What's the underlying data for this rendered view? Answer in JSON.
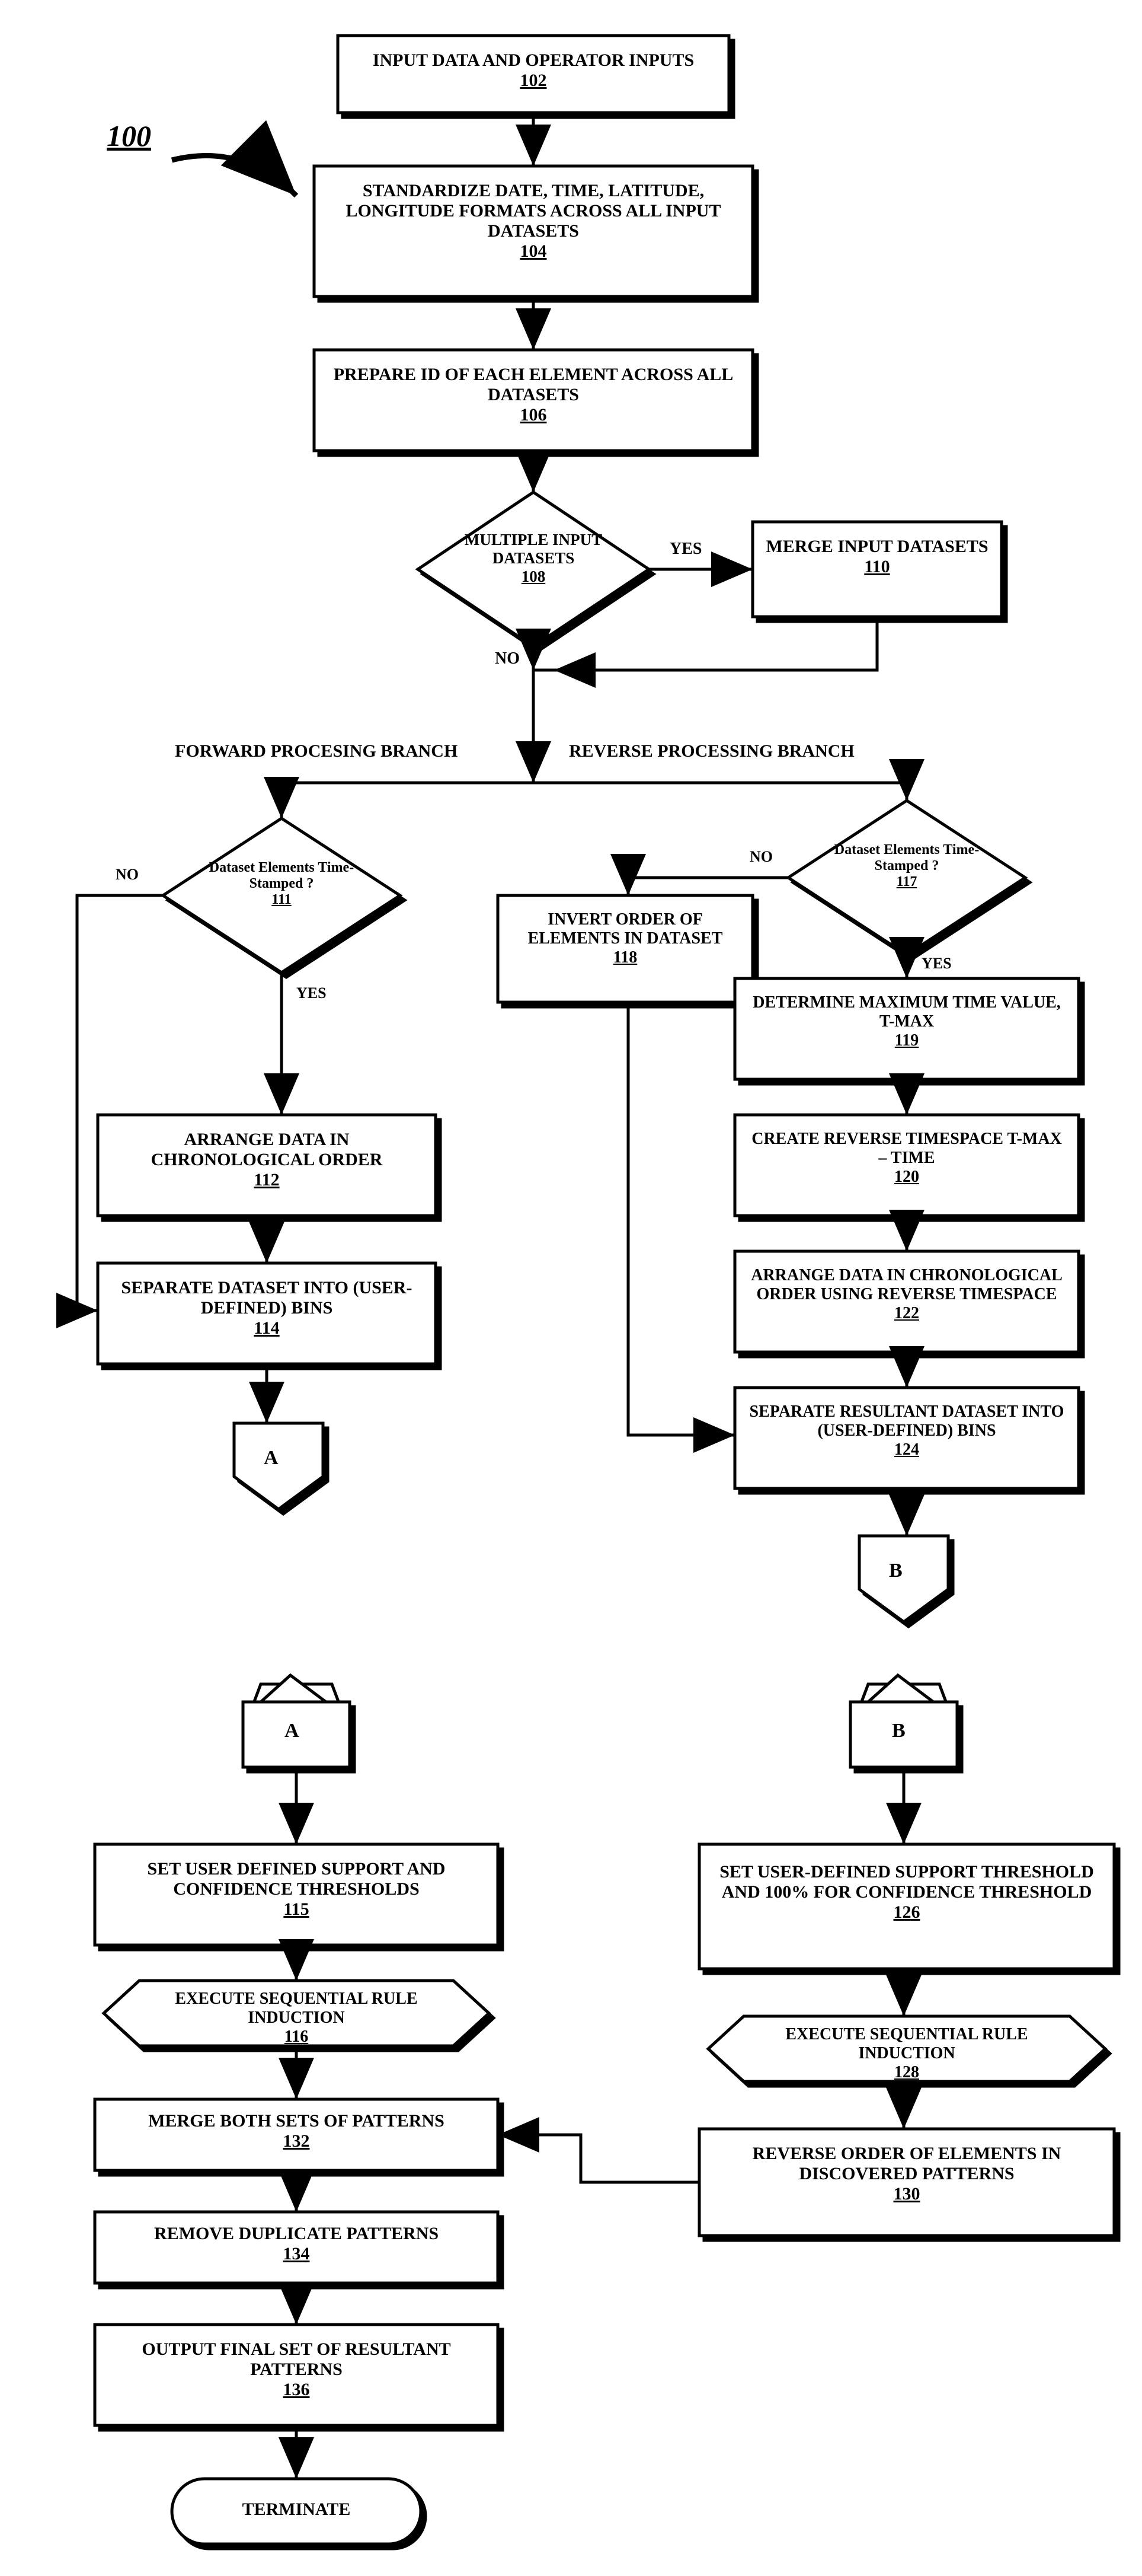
{
  "figure_label": "100",
  "branches": {
    "forward": "FORWARD  PROCESING BRANCH",
    "reverse": "REVERSE PROCESSING BRANCH"
  },
  "edge_labels": {
    "yes": "YES",
    "no": "NO"
  },
  "nodes": {
    "n102": {
      "text": "INPUT DATA AND OPERATOR INPUTS",
      "ref": "102"
    },
    "n104": {
      "text": "STANDARDIZE DATE, TIME, LATITUDE, LONGITUDE FORMATS ACROSS ALL INPUT DATASETS",
      "ref": "104"
    },
    "n106": {
      "text": "PREPARE ID OF EACH ELEMENT ACROSS ALL DATASETS",
      "ref": "106"
    },
    "n108": {
      "text": "MULTIPLE INPUT DATASETS",
      "ref": "108"
    },
    "n110": {
      "text": "MERGE INPUT DATASETS",
      "ref": "110"
    },
    "n111": {
      "text": "Dataset Elements Time-Stamped ?",
      "ref": "111"
    },
    "n117": {
      "text": "Dataset Elements Time-Stamped ?",
      "ref": "117"
    },
    "n118": {
      "text": "INVERT ORDER OF ELEMENTS IN DATASET",
      "ref": "118"
    },
    "n119": {
      "text": "DETERMINE MAXIMUM TIME VALUE, T-MAX",
      "ref": "119"
    },
    "n120": {
      "text": "CREATE REVERSE TIMESPACE T-MAX – TIME",
      "ref": "120"
    },
    "n122": {
      "text": "ARRANGE DATA IN CHRONOLOGICAL ORDER USING REVERSE TIMESPACE",
      "ref": "122"
    },
    "n124": {
      "text": "SEPARATE RESULTANT DATASET  INTO (USER-DEFINED) BINS",
      "ref": "124"
    },
    "n112": {
      "text": "ARRANGE DATA IN CHRONOLOGICAL ORDER",
      "ref": "112"
    },
    "n114": {
      "text": "SEPARATE DATASET INTO (USER-DEFINED) BINS",
      "ref": "114"
    },
    "connA": "A",
    "connB": "B",
    "n115": {
      "text": "SET USER DEFINED SUPPORT AND CONFIDENCE THRESHOLDS",
      "ref": "115"
    },
    "n116": {
      "text": "EXECUTE SEQUENTIAL RULE INDUCTION",
      "ref": "116"
    },
    "n126": {
      "text": "SET USER-DEFINED SUPPORT THRESHOLD AND 100% FOR CONFIDENCE THRESHOLD",
      "ref": "126"
    },
    "n128": {
      "text": "EXECUTE SEQUENTIAL RULE INDUCTION",
      "ref": "128"
    },
    "n130": {
      "text": "REVERSE ORDER OF ELEMENTS IN DISCOVERED PATTERNS",
      "ref": "130"
    },
    "n132": {
      "text": "MERGE BOTH SETS OF PATTERNS",
      "ref": "132"
    },
    "n134": {
      "text": "REMOVE DUPLICATE PATTERNS",
      "ref": "134"
    },
    "n136": {
      "text": "OUTPUT FINAL SET OF RESULTANT PATTERNS",
      "ref": "136"
    },
    "terminate": "TERMINATE"
  }
}
